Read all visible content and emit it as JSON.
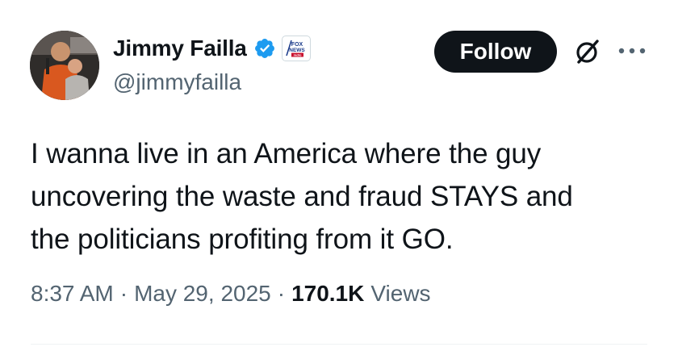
{
  "author": {
    "display_name": "Jimmy Failla",
    "handle": "@jimmyfailla",
    "verified": true,
    "affiliate_badge": "FOX NEWS radio"
  },
  "actions": {
    "follow_label": "Follow",
    "grok_icon": "grok-icon",
    "more_icon": "more-icon"
  },
  "tweet": {
    "lines": [
      "I wanna live in an America where the guy",
      "uncovering the waste and fraud STAYS and",
      "the politicians profiting from it GO."
    ]
  },
  "meta": {
    "time": "8:37 AM",
    "separator": "·",
    "date": "May 29, 2025",
    "views_count": "170.1K",
    "views_label": "Views"
  },
  "colors": {
    "text": "#0f1419",
    "secondary": "#536471",
    "verified_blue": "#1d9bf0",
    "follow_bg": "#0f1419"
  }
}
